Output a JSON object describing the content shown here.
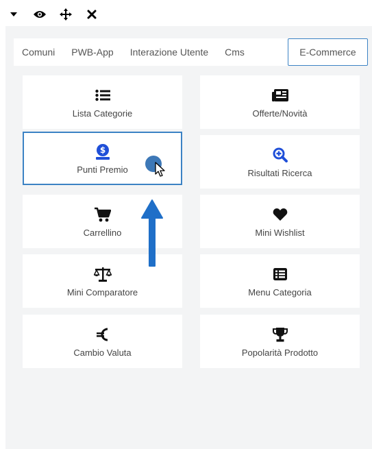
{
  "toolbar": {
    "icons": [
      "caret-down-icon",
      "eye-icon",
      "move-icon",
      "close-icon"
    ]
  },
  "tabs": [
    {
      "label": "Comuni",
      "active": false
    },
    {
      "label": "PWB-App",
      "active": false
    },
    {
      "label": "Interazione Utente",
      "active": false
    },
    {
      "label": "Cms",
      "active": false
    },
    {
      "label": "E-Commerce",
      "active": true
    }
  ],
  "tiles": [
    {
      "label": "Lista Categorie",
      "icon": "list-icon"
    },
    {
      "label": "Offerte/Novità",
      "icon": "newspaper-icon"
    },
    {
      "label": "Punti Premio",
      "icon": "money-bag-icon",
      "selected": true
    },
    {
      "label": "Risultati Ricerca",
      "icon": "search-plus-icon"
    },
    {
      "label": "Carrellino",
      "icon": "cart-icon"
    },
    {
      "label": "Mini Wishlist",
      "icon": "heart-icon"
    },
    {
      "label": "Mini Comparatore",
      "icon": "balance-scale-icon"
    },
    {
      "label": "Menu Categoria",
      "icon": "list-alt-icon"
    },
    {
      "label": "Cambio Valuta",
      "icon": "euro-icon"
    },
    {
      "label": "Popolarità Prodotto",
      "icon": "trophy-icon"
    }
  ],
  "colors": {
    "accent": "#3b82c4",
    "icon_blue": "#1f4fd8",
    "canvas_bg": "#f3f4f5"
  }
}
